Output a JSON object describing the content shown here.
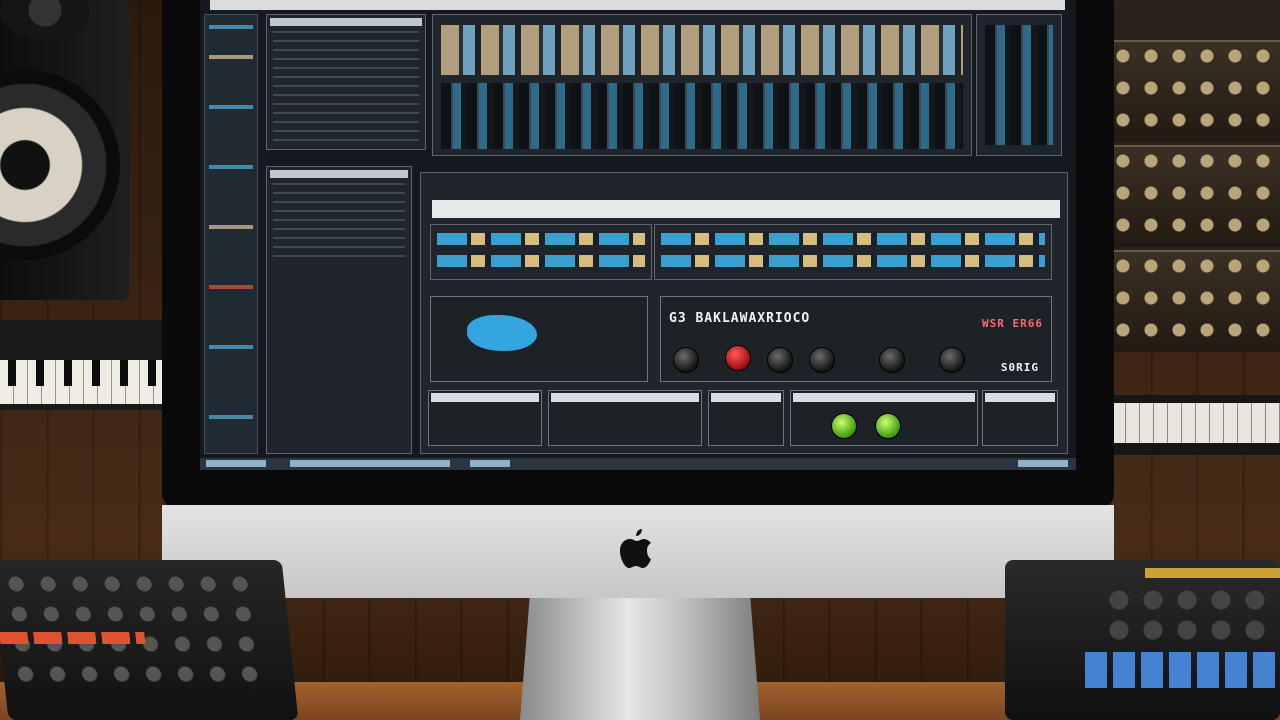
{
  "scene": {
    "description_objects": [
      "studio-monitor-speaker",
      "imac-computer",
      "synthesizer-keyboard",
      "modular-synth",
      "midi-controller-left",
      "midi-controller-right",
      "wooden-desk"
    ]
  },
  "screen": {
    "plugin": {
      "title_text": "G3 BAKLAWAXRIOCO",
      "badge_text": "WSR ER66",
      "sub_text": "S0RIG"
    }
  },
  "colors": {
    "accent_blue": "#3ba0cf",
    "clip_tan": "#c9b38a",
    "knob_red": "#c0161a",
    "knob_green": "#74d12b",
    "desk_wood": "#a3622e"
  },
  "icons": {
    "apple": "apple-logo-icon"
  }
}
